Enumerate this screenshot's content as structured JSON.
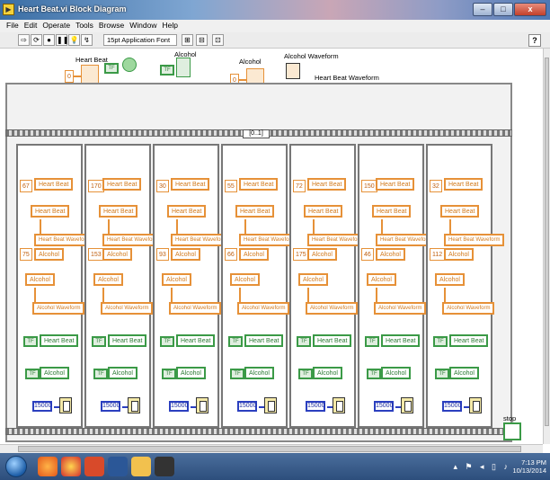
{
  "window": {
    "title": "Heart Beat.vi Block Diagram",
    "minimize": "–",
    "maximize": "□",
    "close": "x"
  },
  "menu": [
    "File",
    "Edit",
    "Operate",
    "Tools",
    "Browse",
    "Window",
    "Help"
  ],
  "toolbar": {
    "font": "15pt Application Font",
    "help": "?"
  },
  "top_terminals": {
    "heart_beat": "Heart Beat",
    "heart_beat_value": "0",
    "alcohol": "Alcohol",
    "alcohol_indicator": "Alcohol",
    "alcohol_value": "0",
    "alcohol_waveform": "Alcohol Waveform",
    "heart_beat_waveform": "Heart Beat Waveform"
  },
  "case_selector": "[0..1]",
  "frames": [
    {
      "hb_value": "67",
      "alc_value": "75"
    },
    {
      "hb_value": "170",
      "alc_value": "153"
    },
    {
      "hb_value": "30",
      "alc_value": "93"
    },
    {
      "hb_value": "55",
      "alc_value": "66"
    },
    {
      "hb_value": "72",
      "alc_value": "175"
    },
    {
      "hb_value": "150",
      "alc_value": "46"
    },
    {
      "hb_value": "32",
      "alc_value": "112"
    }
  ],
  "frame_labels": {
    "heart_beat": "Heart Beat",
    "heart_beat_waveform": "Heart Beat Waveform",
    "alcohol": "Alcohol",
    "alcohol_waveform": "Alcohol Waveform",
    "wait_ms": "15000"
  },
  "stop_label": "stop",
  "taskbar": {
    "time": "7:13 PM",
    "date": "10/13/2014"
  }
}
